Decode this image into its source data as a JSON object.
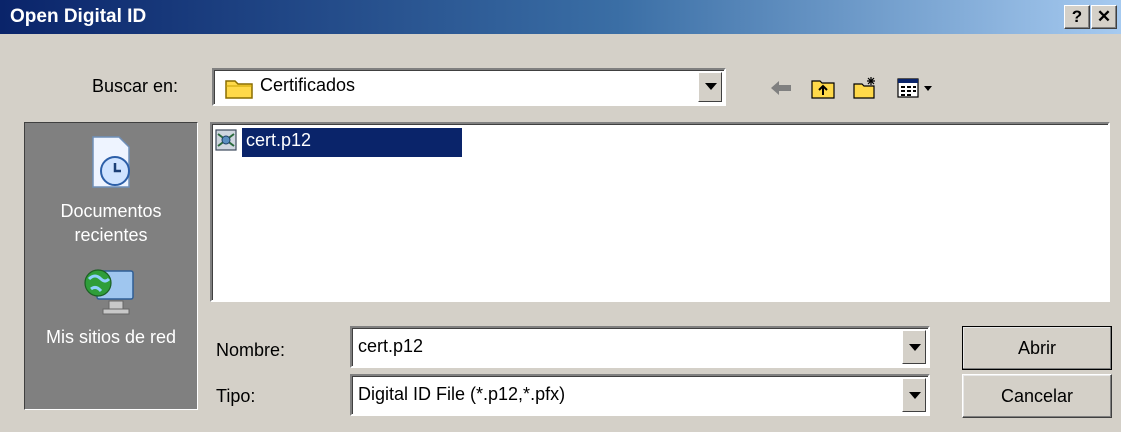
{
  "window": {
    "title": "Open Digital ID",
    "help_label": "?",
    "close_label": "✕"
  },
  "lookin": {
    "label": "Buscar en:",
    "value": "Certificados"
  },
  "places": {
    "recent_label": "Documentos recientes",
    "network_label": "Mis sitios de red"
  },
  "files": [
    {
      "name": "cert.p12",
      "selected": true
    }
  ],
  "filename": {
    "label": "Nombre:",
    "value": "cert.p12"
  },
  "filetype": {
    "label": "Tipo:",
    "value": "Digital ID File (*.p12,*.pfx)"
  },
  "buttons": {
    "open_label": "Abrir",
    "cancel_label": "Cancelar"
  },
  "colors": {
    "titlebar_start": "#0a246a",
    "titlebar_end": "#a6caf0",
    "selection": "#0a246a",
    "face": "#d4d0c8"
  }
}
